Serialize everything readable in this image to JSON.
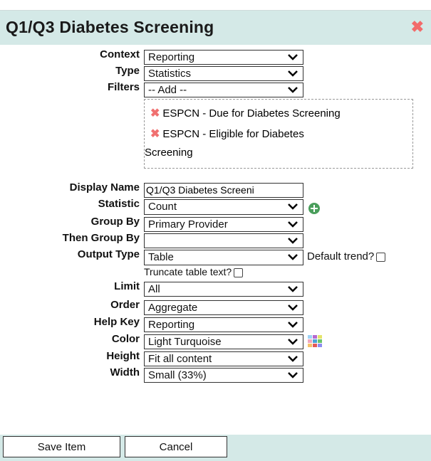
{
  "dialog": {
    "title": "Q1/Q3 Diabetes Screening",
    "close_label": "✖"
  },
  "form": {
    "context": {
      "label": "Context",
      "value": "Reporting"
    },
    "type": {
      "label": "Type",
      "value": "Statistics"
    },
    "filters": {
      "label": "Filters",
      "value": "-- Add --",
      "items": [
        {
          "text": "ESPCN - Due for Diabetes Screening"
        },
        {
          "text": "ESPCN - Eligible for Diabetes",
          "continuation": "Screening"
        }
      ]
    },
    "display_name": {
      "label": "Display Name",
      "value": "Q1/Q3 Diabetes Screeni"
    },
    "statistic": {
      "label": "Statistic",
      "value": "Count"
    },
    "group_by": {
      "label": "Group By",
      "value": "Primary Provider"
    },
    "then_group_by": {
      "label": "Then Group By",
      "value": ""
    },
    "output_type": {
      "label": "Output Type",
      "value": "Table"
    },
    "default_trend": {
      "label": "Default trend?",
      "checked": false
    },
    "truncate_table_text": {
      "label": "Truncate table text?",
      "checked": false
    },
    "limit": {
      "label": "Limit",
      "value": "All"
    },
    "order": {
      "label": "Order",
      "value": "Aggregate"
    },
    "help_key": {
      "label": "Help Key",
      "value": "Reporting"
    },
    "color": {
      "label": "Color",
      "value": "Light Turquoise"
    },
    "height": {
      "label": "Height",
      "value": "Fit all content"
    },
    "width": {
      "label": "Width",
      "value": "Small (33%)"
    }
  },
  "footer": {
    "save_label": "Save Item",
    "cancel_label": "Cancel"
  },
  "colors": {
    "header_bg": "#d4e9e7",
    "close_red": "#f26b6b",
    "add_green": "#4a9e5c"
  }
}
